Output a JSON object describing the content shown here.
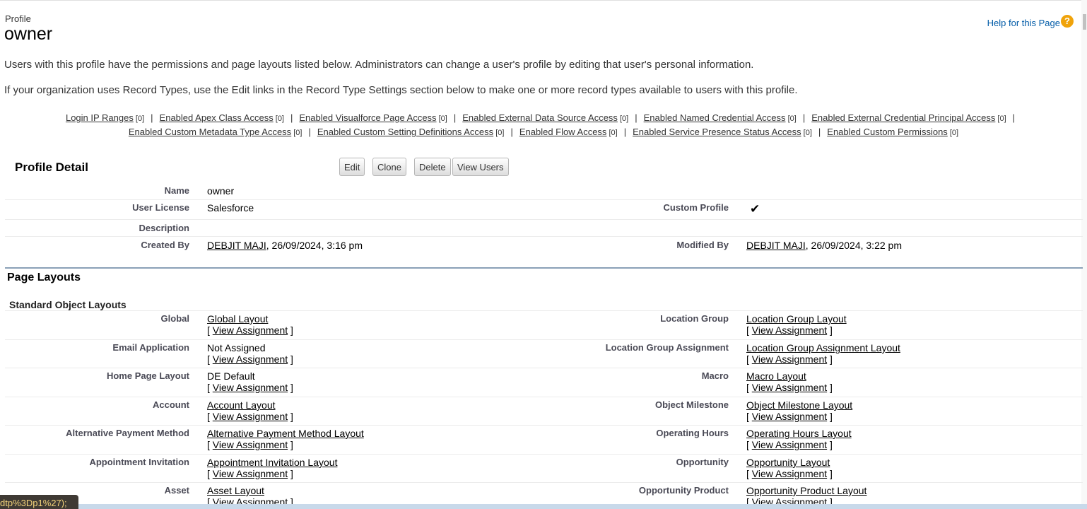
{
  "header": {
    "crumb": "Profile",
    "title": "owner",
    "help_label": "Help for this Page",
    "help_icon": "?"
  },
  "intro": {
    "line1": "Users with this profile have the permissions and page layouts listed below. Administrators can change a user's profile by editing that user's personal information.",
    "line2": "If your organization uses Record Types, use the Edit links in the Record Type Settings section below to make one or more record types available to users with this profile."
  },
  "related_links": {
    "row1": [
      {
        "label": "Login IP Ranges",
        "count": "[0]"
      },
      {
        "label": "Enabled Apex Class Access",
        "count": "[0]"
      },
      {
        "label": "Enabled Visualforce Page Access",
        "count": "[0]"
      },
      {
        "label": "Enabled External Data Source Access",
        "count": "[0]"
      },
      {
        "label": "Enabled Named Credential Access",
        "count": "[0]"
      },
      {
        "label": "Enabled External Credential Principal Access",
        "count": "[0]"
      }
    ],
    "row2": [
      {
        "label": "Enabled Custom Metadata Type Access",
        "count": "[0]"
      },
      {
        "label": "Enabled Custom Setting Definitions Access",
        "count": "[0]"
      },
      {
        "label": "Enabled Flow Access",
        "count": "[0]"
      },
      {
        "label": "Enabled Service Presence Status Access",
        "count": "[0]"
      },
      {
        "label": "Enabled Custom Permissions",
        "count": "[0]"
      }
    ],
    "separator": "|"
  },
  "profile_detail": {
    "title": "Profile Detail",
    "buttons": {
      "edit": "Edit",
      "clone": "Clone",
      "delete": "Delete",
      "view_users": "View Users"
    },
    "name_label": "Name",
    "name_value": "owner",
    "license_label": "User License",
    "license_value": "Salesforce",
    "custom_profile_label": "Custom Profile",
    "custom_profile_check": "✔",
    "description_label": "Description",
    "created_by_label": "Created By",
    "created_by_user": "DEBJIT MAJI",
    "created_by_date": ", 26/09/2024, 3:16 pm",
    "modified_by_label": "Modified By",
    "modified_by_user": "DEBJIT MAJI",
    "modified_by_date": ", 26/09/2024, 3:22 pm"
  },
  "page_layouts": {
    "title": "Page Layouts",
    "subsection": "Standard Object Layouts",
    "view_open": "[ ",
    "view_label": "View Assignment",
    "view_close": " ]",
    "left": [
      {
        "label": "Global",
        "value": "Global Layout",
        "linked": true
      },
      {
        "label": "Email Application",
        "value": "Not Assigned",
        "linked": false
      },
      {
        "label": "Home Page Layout",
        "value": "DE Default",
        "linked": false
      },
      {
        "label": "Account",
        "value": "Account Layout",
        "linked": true
      },
      {
        "label": "Alternative Payment Method",
        "value": "Alternative Payment Method Layout",
        "linked": true
      },
      {
        "label": "Appointment Invitation",
        "value": "Appointment Invitation Layout",
        "linked": true
      },
      {
        "label": "Asset",
        "value": "Asset Layout",
        "linked": true
      }
    ],
    "right": [
      {
        "label": "Location Group",
        "value": "Location Group Layout",
        "linked": true
      },
      {
        "label": "Location Group Assignment",
        "value": "Location Group Assignment Layout",
        "linked": true
      },
      {
        "label": "Macro",
        "value": "Macro Layout",
        "linked": true
      },
      {
        "label": "Object Milestone",
        "value": "Object Milestone Layout",
        "linked": true
      },
      {
        "label": "Operating Hours",
        "value": "Operating Hours Layout",
        "linked": true
      },
      {
        "label": "Opportunity",
        "value": "Opportunity Layout",
        "linked": true
      },
      {
        "label": "Opportunity Product",
        "value": "Opportunity Product Layout",
        "linked": true
      }
    ]
  },
  "status_tooltip": "dtp%3Dp1%27);"
}
